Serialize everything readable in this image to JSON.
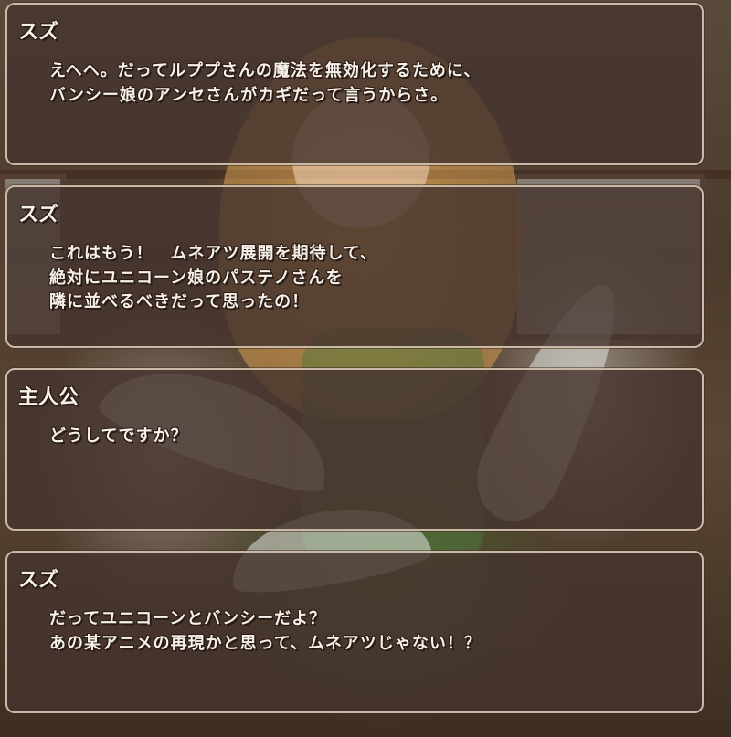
{
  "dialog_log": [
    {
      "speaker": "スズ",
      "lines": [
        "えへへ。だってルププさんの魔法を無効化するために、",
        "バンシー娘のアンセさんがカギだって言うからさ。"
      ]
    },
    {
      "speaker": "スズ",
      "lines": [
        "これはもう！　ムネアツ展開を期待して、",
        "絶対にユニコーン娘のパステノさんを",
        "隣に並べるべきだって思ったの！"
      ]
    },
    {
      "speaker": "主人公",
      "lines": [
        "どうしてですか？"
      ]
    },
    {
      "speaker": "スズ",
      "lines": [
        "だってユニコーンとバンシーだよ？",
        "あの某アニメの再現かと思って、ムネアツじゃない！？"
      ]
    }
  ],
  "colors": {
    "panel_bg": "#46342e",
    "panel_border": "#c9b9a6",
    "text": "#f6f1ea"
  }
}
